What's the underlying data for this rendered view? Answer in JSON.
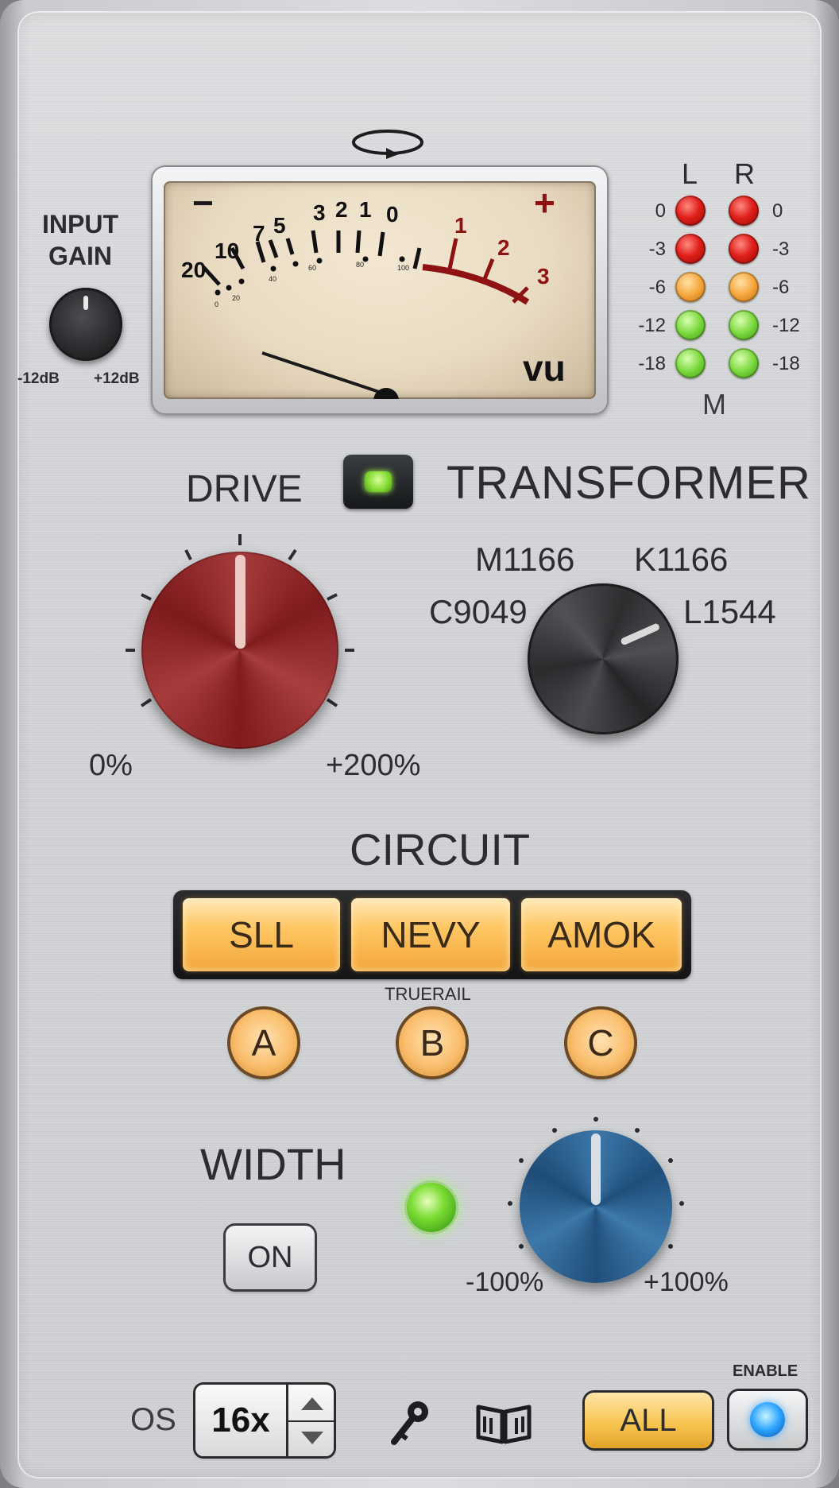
{
  "input_gain": {
    "title_line1": "INPUT",
    "title_line2": "GAIN",
    "min_label": "-12dB",
    "max_label": "+12dB"
  },
  "vu_meter": {
    "minus_sign": "−",
    "plus_sign": "+",
    "unit": "vu",
    "scale_labels": [
      "20",
      "10",
      "7",
      "5",
      "3",
      "2",
      "1",
      "0",
      "1",
      "2",
      "3"
    ],
    "percent_labels": [
      "0",
      "20",
      "40",
      "60",
      "80",
      "100"
    ],
    "needle_reading": "20"
  },
  "level_meters": {
    "left_header": "L",
    "right_header": "R",
    "mode_label": "M",
    "db_labels": [
      "0",
      "-3",
      "-6",
      "-12",
      "-18"
    ],
    "led_colors": [
      "red",
      "red",
      "orange",
      "green",
      "green"
    ]
  },
  "drive": {
    "title": "DRIVE",
    "min_label": "0%",
    "max_label": "+200%"
  },
  "transformer": {
    "title": "TRANSFORMER",
    "options": [
      "M1166",
      "K1166",
      "C9049",
      "L1544"
    ],
    "selected": "L1544"
  },
  "circuit": {
    "title": "CIRCUIT",
    "buttons": [
      "SLL",
      "NEVY",
      "AMOK"
    ],
    "truerail_label": "TRUERAIL",
    "variants": [
      "A",
      "B",
      "C"
    ]
  },
  "width": {
    "title": "WIDTH",
    "on_label": "ON",
    "min_label": "-100%",
    "max_label": "+100%"
  },
  "footer": {
    "os_label": "OS",
    "os_value": "16x",
    "all_label": "ALL",
    "enable_label": "ENABLE"
  },
  "colors": {
    "drive_knob": "#8f2a2c",
    "width_knob": "#2f6796",
    "circuit_button": "#f9be5a",
    "led_red": "#e11f1a",
    "led_orange": "#f5a53a",
    "led_green": "#79d83b",
    "vu_needle_red": "#8e1212"
  }
}
